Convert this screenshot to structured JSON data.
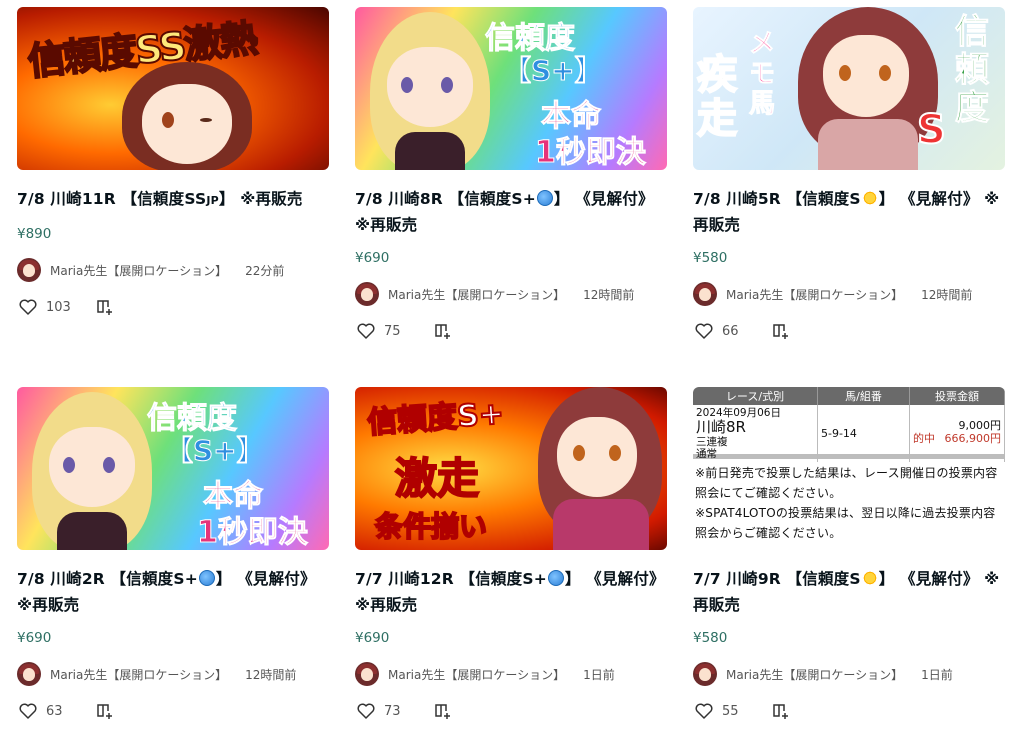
{
  "colors": {
    "price": "#2e6f63",
    "accent_red": "#c0392b"
  },
  "cards": [
    {
      "thumb_text": [
        "信頼度SS激熱"
      ],
      "title": "7/8 川崎11R 【信頼度SS",
      "title_suffix": "JP",
      "title_tail": "】 ※再販売",
      "badge": "",
      "price": "¥890",
      "author": "Maria先生【展開ロケーション】",
      "time": "22分前",
      "likes": "103"
    },
    {
      "thumb_text": [
        "信頼度",
        "【S+】",
        "本命",
        "1秒即決"
      ],
      "title": "7/8 川崎8R 【信頼度S+",
      "badge": "globe",
      "title_tail": "】 《見解付》 ※再販売",
      "price": "¥690",
      "author": "Maria先生【展開ロケーション】",
      "time": "12時間前",
      "likes": "75"
    },
    {
      "thumb_text": [
        "疾走",
        "メモ馬",
        "信頼度",
        "S"
      ],
      "title": "7/8 川崎5R 【信頼度S",
      "badge": "sun",
      "title_tail": "】 《見解付》 ※再販売",
      "price": "¥580",
      "author": "Maria先生【展開ロケーション】",
      "time": "12時間前",
      "likes": "66"
    },
    {
      "thumb_text": [
        "信頼度",
        "【S+】",
        "本命",
        "1秒即決"
      ],
      "title": "7/8 川崎2R 【信頼度S+",
      "badge": "globe",
      "title_tail": "】 《見解付》 ※再販売",
      "price": "¥690",
      "author": "Maria先生【展開ロケーション】",
      "time": "12時間前",
      "likes": "63"
    },
    {
      "thumb_text": [
        "信頼度S+",
        "激走",
        "条件揃い"
      ],
      "title": "7/7 川崎12R 【信頼度S+",
      "badge": "globe",
      "title_tail": "】 《見解付》 ※再販売",
      "price": "¥690",
      "author": "Maria先生【展開ロケーション】",
      "time": "1日前",
      "likes": "73"
    },
    {
      "receipt": {
        "headers": [
          "レース/式別",
          "馬/組番",
          "投票金額"
        ],
        "date": "2024年09月06日",
        "race": "川崎8R",
        "bet_type": "三連複",
        "mode": "通常",
        "combo": "5-9-14",
        "amount": "9,000円",
        "hit_label": "的中",
        "payout": "666,900円",
        "notes": [
          "※前日発売で投票した結果は、レース開催日の投票内容照会にてご確認ください。",
          "※SPAT4LOTOの投票結果は、翌日以降に過去投票内容照会からご確認ください。"
        ]
      },
      "title": "7/7 川崎9R 【信頼度S",
      "badge": "sun",
      "title_tail": "】 《見解付》 ※再販売",
      "price": "¥580",
      "author": "Maria先生【展開ロケーション】",
      "time": "1日前",
      "likes": "55"
    }
  ]
}
